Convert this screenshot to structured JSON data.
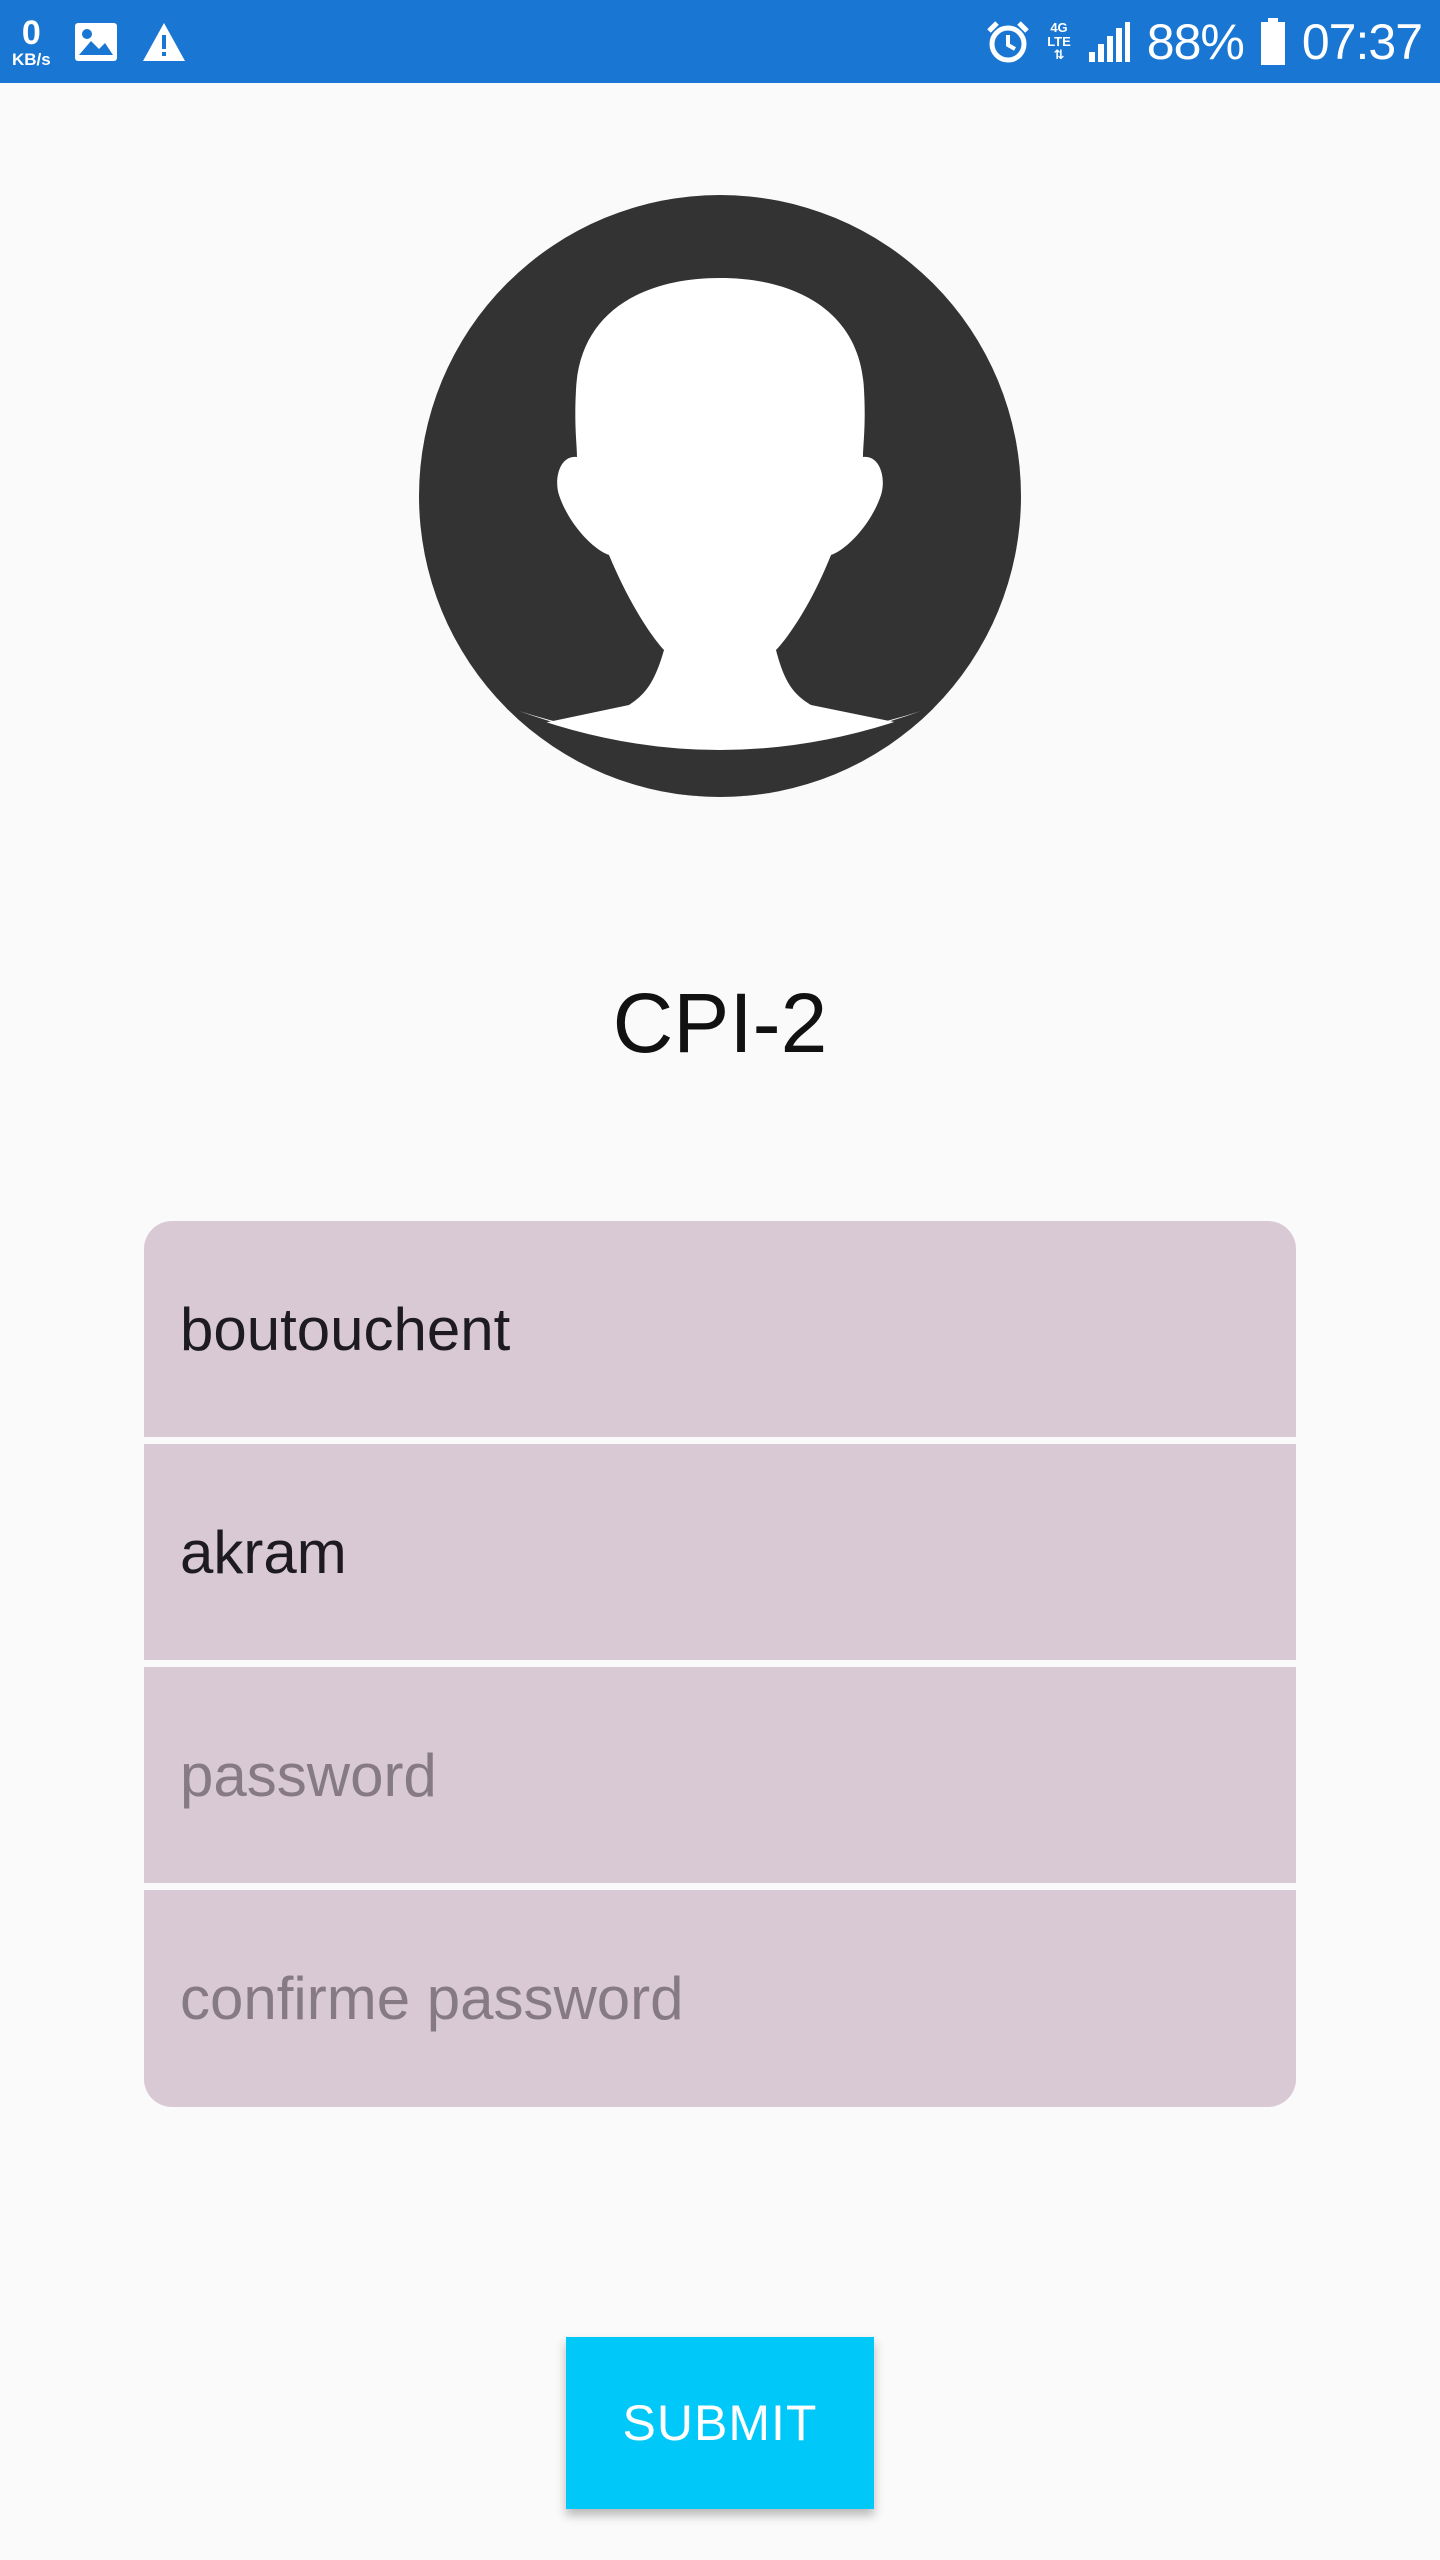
{
  "status_bar": {
    "speed_value": "0",
    "speed_unit": "KB/s",
    "network_type": "4G",
    "network_sub": "LTE",
    "battery": "88%",
    "time": "07:37",
    "icons": [
      "image-icon",
      "warning-icon",
      "alarm-icon",
      "lte-icon",
      "signal-icon",
      "battery-icon"
    ],
    "color": "#1976d2"
  },
  "avatar": {
    "icon": "default-user-avatar-icon"
  },
  "title": "CPI-2",
  "form": {
    "last_name": {
      "value": "boutouchent",
      "placeholder": ""
    },
    "first_name": {
      "value": "akram",
      "placeholder": ""
    },
    "password": {
      "value": "",
      "placeholder": "password"
    },
    "confirm_password": {
      "value": "",
      "placeholder": "confirme password"
    },
    "field_color": "#d9c9d4"
  },
  "submit": {
    "label": "SUBMIT",
    "color": "#00c8f8"
  }
}
